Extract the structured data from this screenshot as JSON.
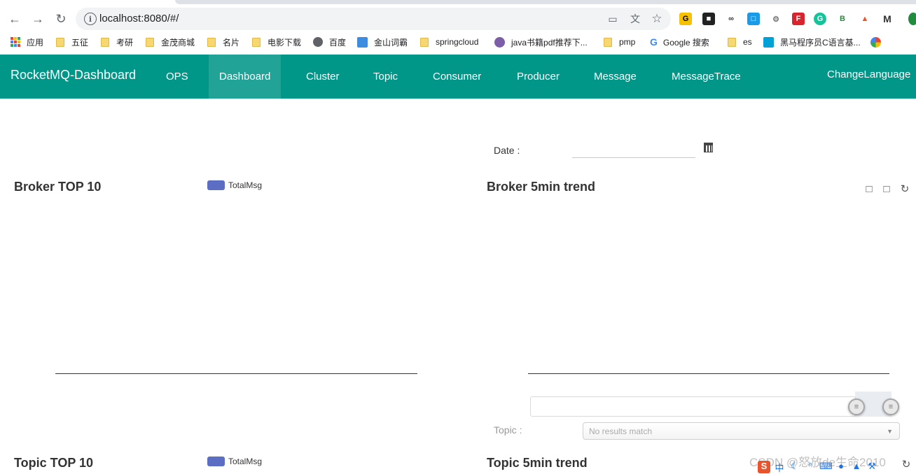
{
  "browser": {
    "url": "localhost:8080/#/",
    "bookmarks": [
      {
        "label": "应用",
        "kind": "apps"
      },
      {
        "label": "五征",
        "kind": "folder"
      },
      {
        "label": "考研",
        "kind": "folder"
      },
      {
        "label": "金茂商城",
        "kind": "folder"
      },
      {
        "label": "名片",
        "kind": "folder"
      },
      {
        "label": "电影下载",
        "kind": "folder"
      },
      {
        "label": "百度",
        "kind": "globe"
      },
      {
        "label": "金山词霸",
        "kind": "fav"
      },
      {
        "label": "springcloud",
        "kind": "folder"
      },
      {
        "label": "java书籍pdf推荐下...",
        "kind": "fav"
      },
      {
        "label": "pmp",
        "kind": "folder"
      },
      {
        "label": "Google 搜索",
        "kind": "google"
      },
      {
        "label": "es",
        "kind": "folder"
      },
      {
        "label": "黑马程序员C语言基...",
        "kind": "fav"
      }
    ]
  },
  "app": {
    "brand": "RocketMQ-Dashboard",
    "nav": [
      {
        "label": "OPS"
      },
      {
        "label": "Dashboard",
        "active": true
      },
      {
        "label": "Cluster"
      },
      {
        "label": "Topic"
      },
      {
        "label": "Consumer"
      },
      {
        "label": "Producer"
      },
      {
        "label": "Message"
      },
      {
        "label": "MessageTrace"
      }
    ],
    "change_language": "ChangeLanguage",
    "accent_color": "#009688"
  },
  "dashboard": {
    "date_label": "Date :",
    "date_value": "",
    "broker_top_title": "Broker TOP 10",
    "broker_trend_title": "Broker 5min trend",
    "topic_top_title": "Topic TOP 10",
    "topic_trend_title": "Topic 5min trend",
    "legend_total": "TotalMsg",
    "topic_label": "Topic :",
    "topic_placeholder": "No results match"
  },
  "watermark": "CSDN @怒放de生命2010"
}
